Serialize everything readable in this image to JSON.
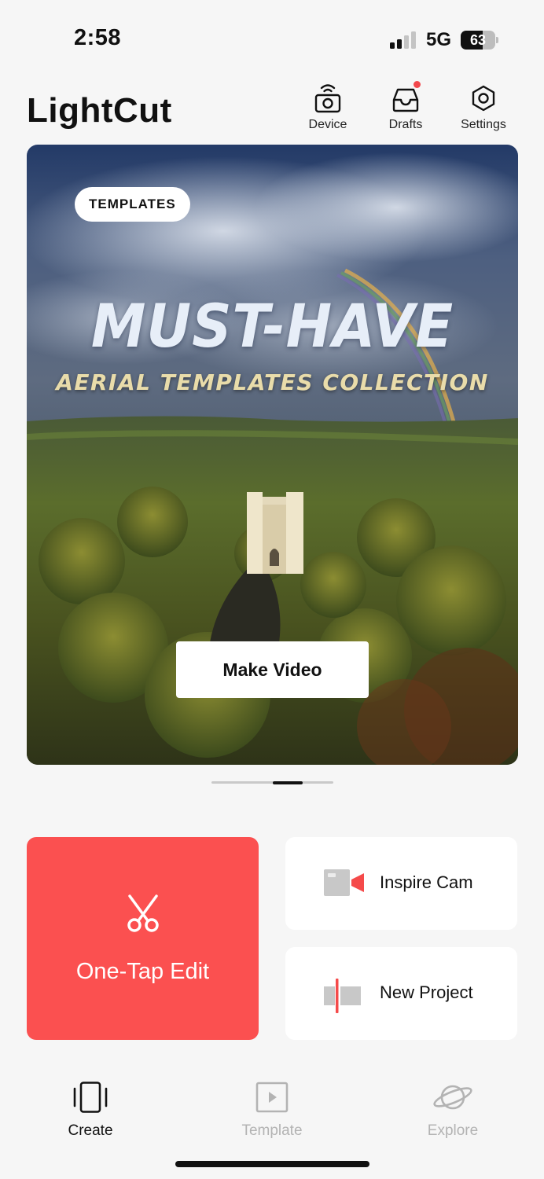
{
  "status_bar": {
    "time": "2:58",
    "network": "5G",
    "battery_level": "63",
    "battery_fraction": 0.63
  },
  "header": {
    "title": "LightCut",
    "actions": [
      {
        "label": "Device",
        "icon": "device-camera-icon"
      },
      {
        "label": "Drafts",
        "icon": "drafts-tray-icon",
        "has_badge": true
      },
      {
        "label": "Settings",
        "icon": "settings-hexagon-icon"
      }
    ]
  },
  "banner": {
    "tag": "TEMPLATES",
    "headline": "MUST-HAVE",
    "subline": "AERIAL TEMPLATES COLLECTION",
    "cta": "Make Video",
    "pager_count": 4,
    "pager_active_index": 2
  },
  "tiles": {
    "primary": {
      "label": "One-Tap Edit",
      "icon": "scissors-icon"
    },
    "inspire": {
      "label": "Inspire Cam",
      "icon": "video-camera-icon"
    },
    "new_project": {
      "label": "New Project",
      "icon": "timeline-icon"
    }
  },
  "tabbar": {
    "tabs": [
      {
        "label": "Create",
        "icon": "create-icon",
        "active": true
      },
      {
        "label": "Template",
        "icon": "template-play-icon",
        "active": false
      },
      {
        "label": "Explore",
        "icon": "planet-icon",
        "active": false
      }
    ]
  },
  "colors": {
    "accent": "#fb5050",
    "badge": "#f2484c",
    "background": "#f6f6f6",
    "inactive_tab": "#b3b3b3"
  }
}
